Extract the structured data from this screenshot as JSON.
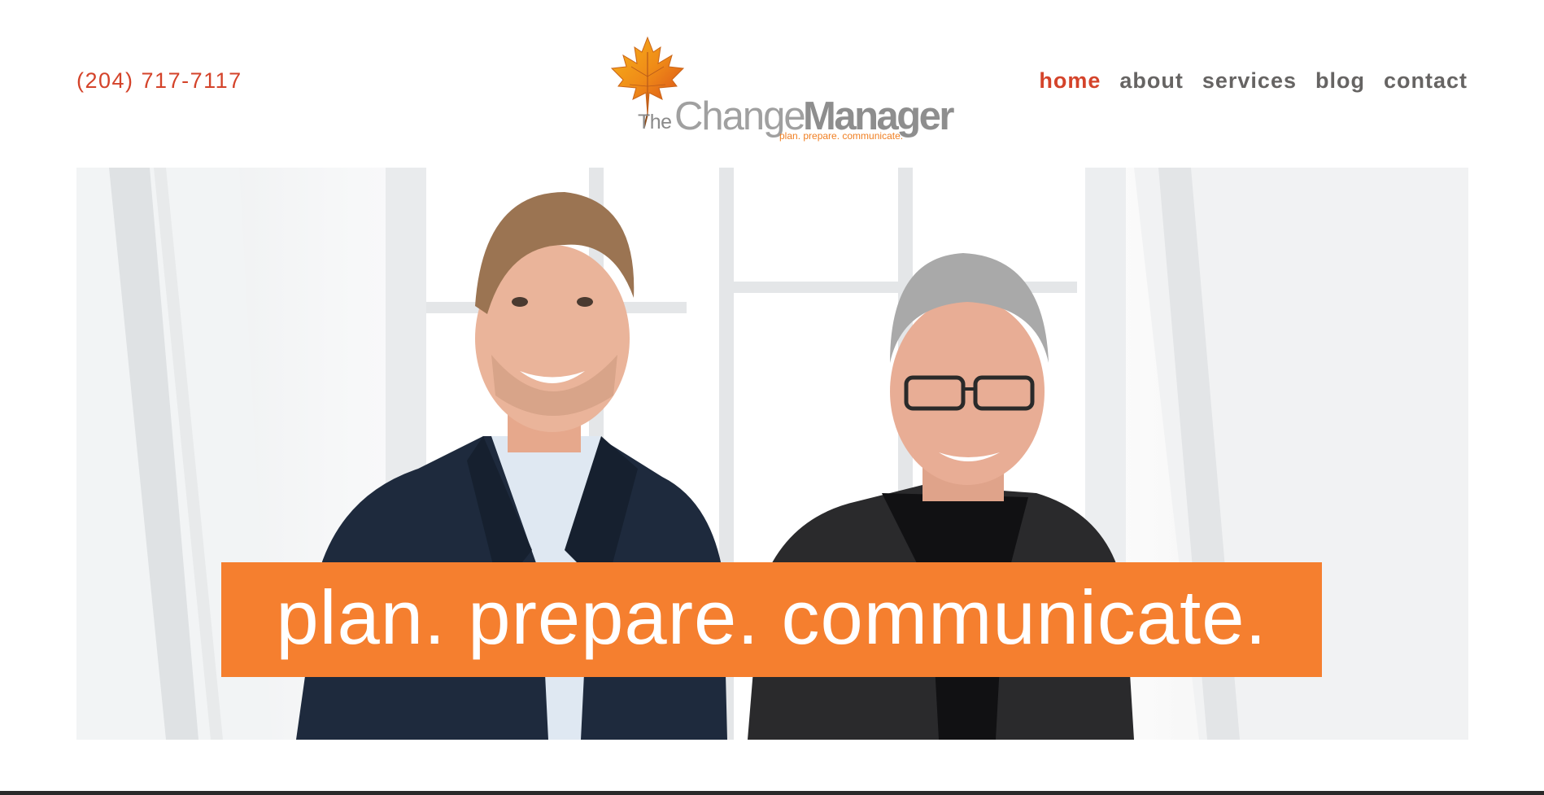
{
  "header": {
    "phone": "(204) 717-7117",
    "logo": {
      "word_the": "The",
      "word_change": "Change",
      "word_manager": "Manager",
      "tagline": "plan. prepare. communicate."
    }
  },
  "nav": {
    "items": [
      {
        "label": "home",
        "active": true
      },
      {
        "label": "about",
        "active": false
      },
      {
        "label": "services",
        "active": false
      },
      {
        "label": "blog",
        "active": false
      },
      {
        "label": "contact",
        "active": false
      }
    ]
  },
  "hero": {
    "tagline": "plan. prepare. communicate."
  },
  "colors": {
    "accent_red": "#d4432a",
    "accent_orange": "#f57f2f",
    "nav_gray": "#666463",
    "logo_gray": "#a0a0a0"
  }
}
